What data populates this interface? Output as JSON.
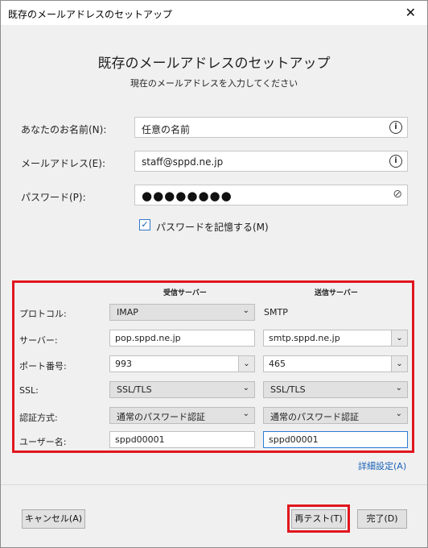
{
  "window": {
    "title": "既存のメールアドレスのセットアップ",
    "close_glyph": "✕"
  },
  "header": {
    "title": "既存のメールアドレスのセットアップ",
    "subtitle": "現在のメールアドレスを入力してください"
  },
  "form": {
    "name_label": "あなたのお名前(N):",
    "name_value": "任意の名前",
    "email_label": "メールアドレス(E):",
    "email_value": "staff@sppd.ne.jp",
    "password_label": "パスワード(P):",
    "password_mask": "●●●●●●●●",
    "remember_label": "パスワードを記憶する(M)",
    "remember_checked": "✓"
  },
  "server": {
    "incoming_header": "受信サーバー",
    "outgoing_header": "送信サーバー",
    "rows": {
      "protocol": {
        "label": "プロトコル:",
        "incoming": "IMAP",
        "outgoing": "SMTP"
      },
      "server": {
        "label": "サーバー:",
        "incoming": "pop.sppd.ne.jp",
        "outgoing": "smtp.sppd.ne.jp"
      },
      "port": {
        "label": "ポート番号:",
        "incoming": "993",
        "outgoing": "465"
      },
      "ssl": {
        "label": "SSL:",
        "incoming": "SSL/TLS",
        "outgoing": "SSL/TLS"
      },
      "auth": {
        "label": "認証方式:",
        "incoming": "通常のパスワード認証",
        "outgoing": "通常のパスワード認証"
      },
      "username": {
        "label": "ユーザー名:",
        "incoming": "sppd00001",
        "outgoing": "sppd00001"
      }
    },
    "advanced_link": "詳細設定(A)"
  },
  "buttons": {
    "cancel": "キャンセル(A)",
    "retest": "再テスト(T)",
    "done": "完了(D)"
  },
  "icons": {
    "info": "i",
    "eye": "⊘",
    "dropdown": "⌄"
  },
  "colors": {
    "highlight": "#e0161e",
    "focus": "#2d7cd6",
    "link": "#1a62b8"
  }
}
